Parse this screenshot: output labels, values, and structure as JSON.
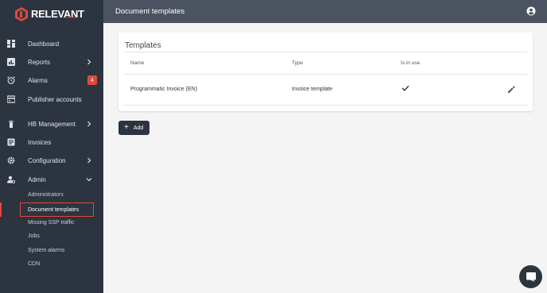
{
  "brand": {
    "name": "RELEVANT",
    "sub": "YIELD",
    "accent": "#e0483b"
  },
  "topbar": {
    "title": "Document templates"
  },
  "sidebar": {
    "items": [
      {
        "label": "Dashboard",
        "icon": "dashboard-icon"
      },
      {
        "label": "Reports",
        "icon": "reports-icon",
        "expandable": true
      },
      {
        "label": "Alarms",
        "icon": "alarm-icon",
        "badge": "4"
      },
      {
        "label": "Publisher accounts",
        "icon": "publisher-icon"
      },
      {
        "label": "HB Management",
        "icon": "hb-icon",
        "expandable": true
      },
      {
        "label": "Invoices",
        "icon": "invoice-icon"
      },
      {
        "label": "Configuration",
        "icon": "gear-icon",
        "expandable": true
      },
      {
        "label": "Admin",
        "icon": "admin-icon",
        "expanded": true
      }
    ],
    "admin_sub": [
      "Administrators",
      "Document templates",
      "Missing SSP traffic",
      "Jobs",
      "System alarms",
      "CDN"
    ]
  },
  "card": {
    "title": "Templates",
    "columns": [
      "Name",
      "Type",
      "Is in use"
    ],
    "rows": [
      {
        "name": "Programmatic Invoice (EN)",
        "type": "Invoice template",
        "in_use": true
      }
    ]
  },
  "add_button": {
    "label": "Add"
  }
}
